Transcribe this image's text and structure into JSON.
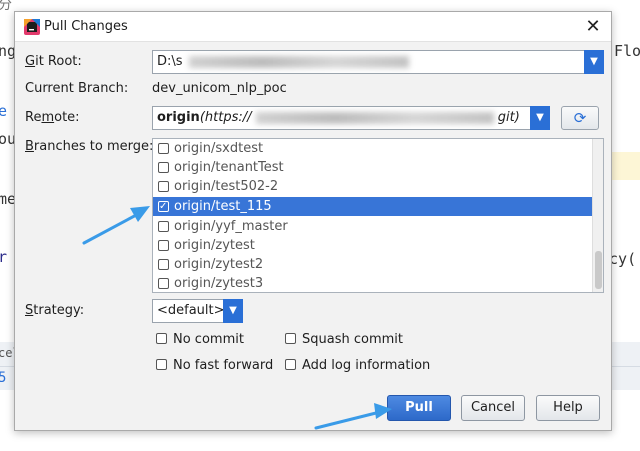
{
  "background": {
    "left_fragments": [
      "ng",
      "e",
      "ou",
      "me",
      "r"
    ],
    "right_fragments": [
      "Flo",
      "ncy("
    ],
    "bottom_left": [
      "cel",
      "5"
    ],
    "top_left": "分"
  },
  "dialog": {
    "title": "Pull Changes",
    "close_label": "✕"
  },
  "git_root": {
    "label": "Git Root:",
    "value_prefix": "D:\\s"
  },
  "current_branch": {
    "label": "Current Branch:",
    "value": "dev_unicom_nlp_poc"
  },
  "remote": {
    "label": "Remote:",
    "value_prefix": "origin",
    "value_url_start": "(https://",
    "value_url_end": "git)"
  },
  "branches": {
    "label": "Branches to merge:",
    "items": [
      {
        "name": "origin/sxdtest",
        "checked": false
      },
      {
        "name": "origin/tenantTest",
        "checked": false
      },
      {
        "name": "origin/test502-2",
        "checked": false
      },
      {
        "name": "origin/test_115",
        "checked": true,
        "selected": true
      },
      {
        "name": "origin/yyf_master",
        "checked": false
      },
      {
        "name": "origin/zytest",
        "checked": false
      },
      {
        "name": "origin/zytest2",
        "checked": false
      },
      {
        "name": "origin/zytest3",
        "checked": false
      }
    ]
  },
  "strategy": {
    "label": "Strategy:",
    "value": "<default>"
  },
  "options": {
    "no_commit": "No commit",
    "squash_commit": "Squash commit",
    "no_fast_forward": "No fast forward",
    "add_log": "Add log information"
  },
  "buttons": {
    "pull": "Pull",
    "cancel": "Cancel",
    "help": "Help"
  },
  "colors": {
    "accent": "#2a6fd6",
    "selection": "#3875d7",
    "annotation_arrow": "#3a9be8"
  }
}
